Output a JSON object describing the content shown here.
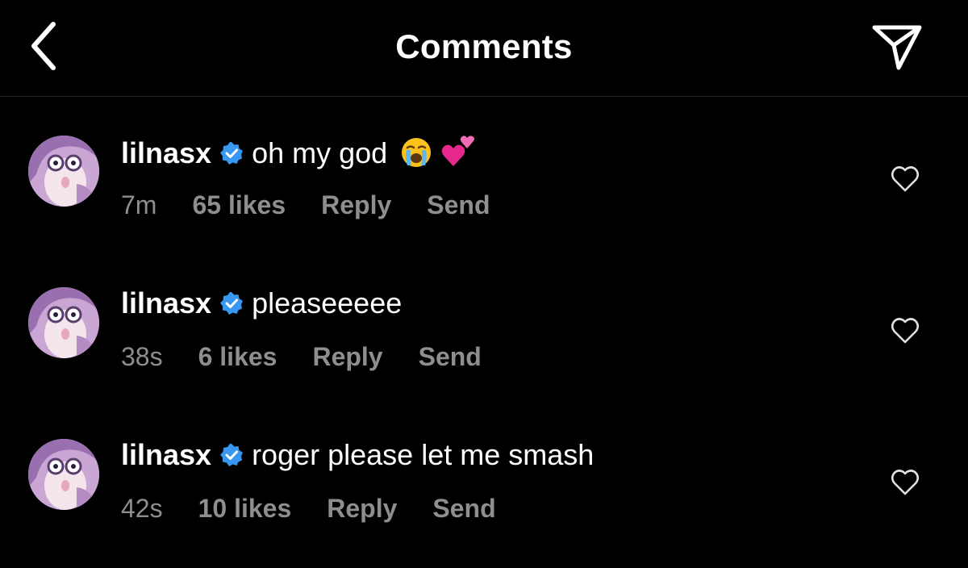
{
  "header": {
    "title": "Comments",
    "back_icon": "chevron-left-icon",
    "share_icon": "paper-plane-icon"
  },
  "colors": {
    "background": "#000000",
    "text": "#ffffff",
    "secondary_text": "#8e8e8e",
    "verified_badge": "#3897f0",
    "divider": "#262626"
  },
  "comments": [
    {
      "username": "lilnasx",
      "verified": true,
      "text": "oh my god",
      "emojis": [
        "loudly-crying-face-emoji",
        "two-hearts-emoji"
      ],
      "time": "7m",
      "likes": "65 likes",
      "reply_label": "Reply",
      "send_label": "Send"
    },
    {
      "username": "lilnasx",
      "verified": true,
      "text": "pleaseeeee",
      "time": "38s",
      "likes": "6 likes",
      "reply_label": "Reply",
      "send_label": "Send"
    },
    {
      "username": "lilnasx",
      "verified": true,
      "text": "roger please let me smash",
      "time": "42s",
      "likes": "10 likes",
      "reply_label": "Reply",
      "send_label": "Send"
    }
  ]
}
